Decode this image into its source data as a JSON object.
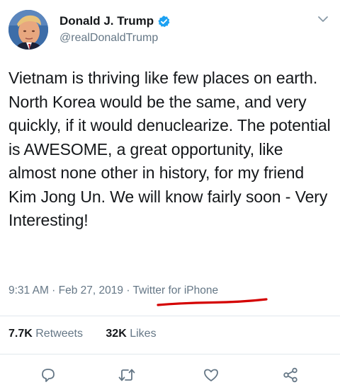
{
  "tweet": {
    "display_name": "Donald J. Trump",
    "handle": "@realDonaldTrump",
    "text": "Vietnam is thriving like few places on earth. North Korea would be the same, and very quickly, if it would denuclearize. The potential is AWESOME, a great opportunity, like almost none other in history, for my friend Kim Jong Un. We will know fairly soon - Very Interesting!",
    "time": "9:31 AM",
    "separator": " · ",
    "date": "Feb 27, 2019",
    "source": "Twitter for iPhone",
    "retweets_count": "7.7K",
    "retweets_label": "Retweets",
    "likes_count": "32K",
    "likes_label": "Likes"
  },
  "colors": {
    "text": "#14171a",
    "muted": "#657786",
    "verified": "#1da1f2",
    "annotation": "#d40000",
    "divider": "#e1e8ed"
  },
  "icons": [
    "verified-badge-icon",
    "chevron-down-icon",
    "reply-icon",
    "retweet-icon",
    "like-icon",
    "share-icon"
  ]
}
